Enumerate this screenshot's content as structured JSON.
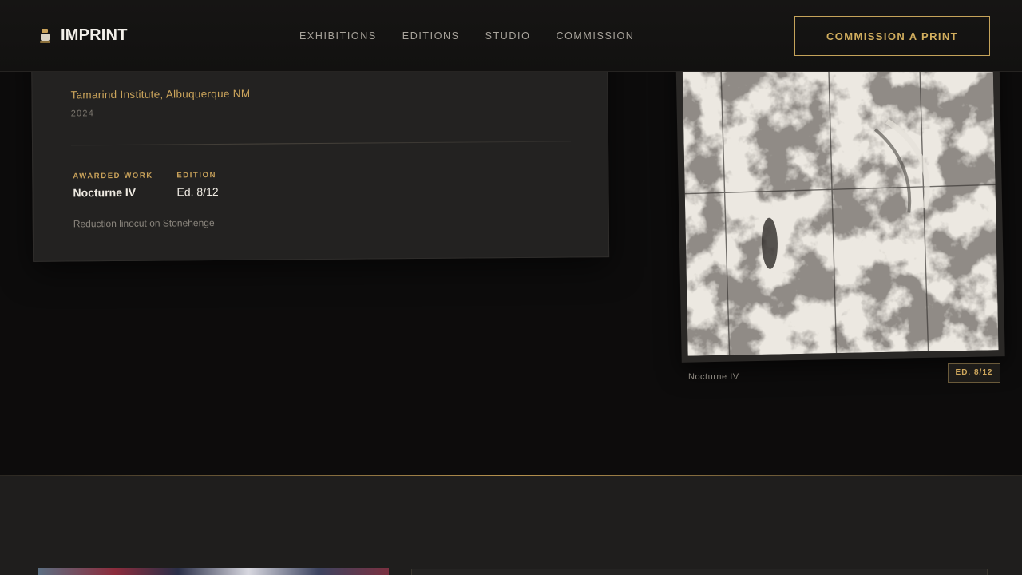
{
  "header": {
    "brand": "IMPRINT",
    "nav": [
      "EXHIBITIONS",
      "EDITIONS",
      "STUDIO",
      "COMMISSION"
    ],
    "cta": "COMMISSION A PRINT"
  },
  "award": {
    "cut_text": "• • •",
    "venue": "Tamarind Institute, Albuquerque NM",
    "year": "2024",
    "awarded_label": "AWARDED WORK",
    "awarded_value": "Nocturne IV",
    "edition_label": "EDITION",
    "edition_value": "Ed. 8/12",
    "medium": "Reduction linocut on Stonehenge"
  },
  "artwork": {
    "caption": "Nocturne IV",
    "badge": "ED. 8/12"
  },
  "colors": {
    "accent": "#c5a35a",
    "background": "#0d0c0c",
    "card": "#232221"
  }
}
